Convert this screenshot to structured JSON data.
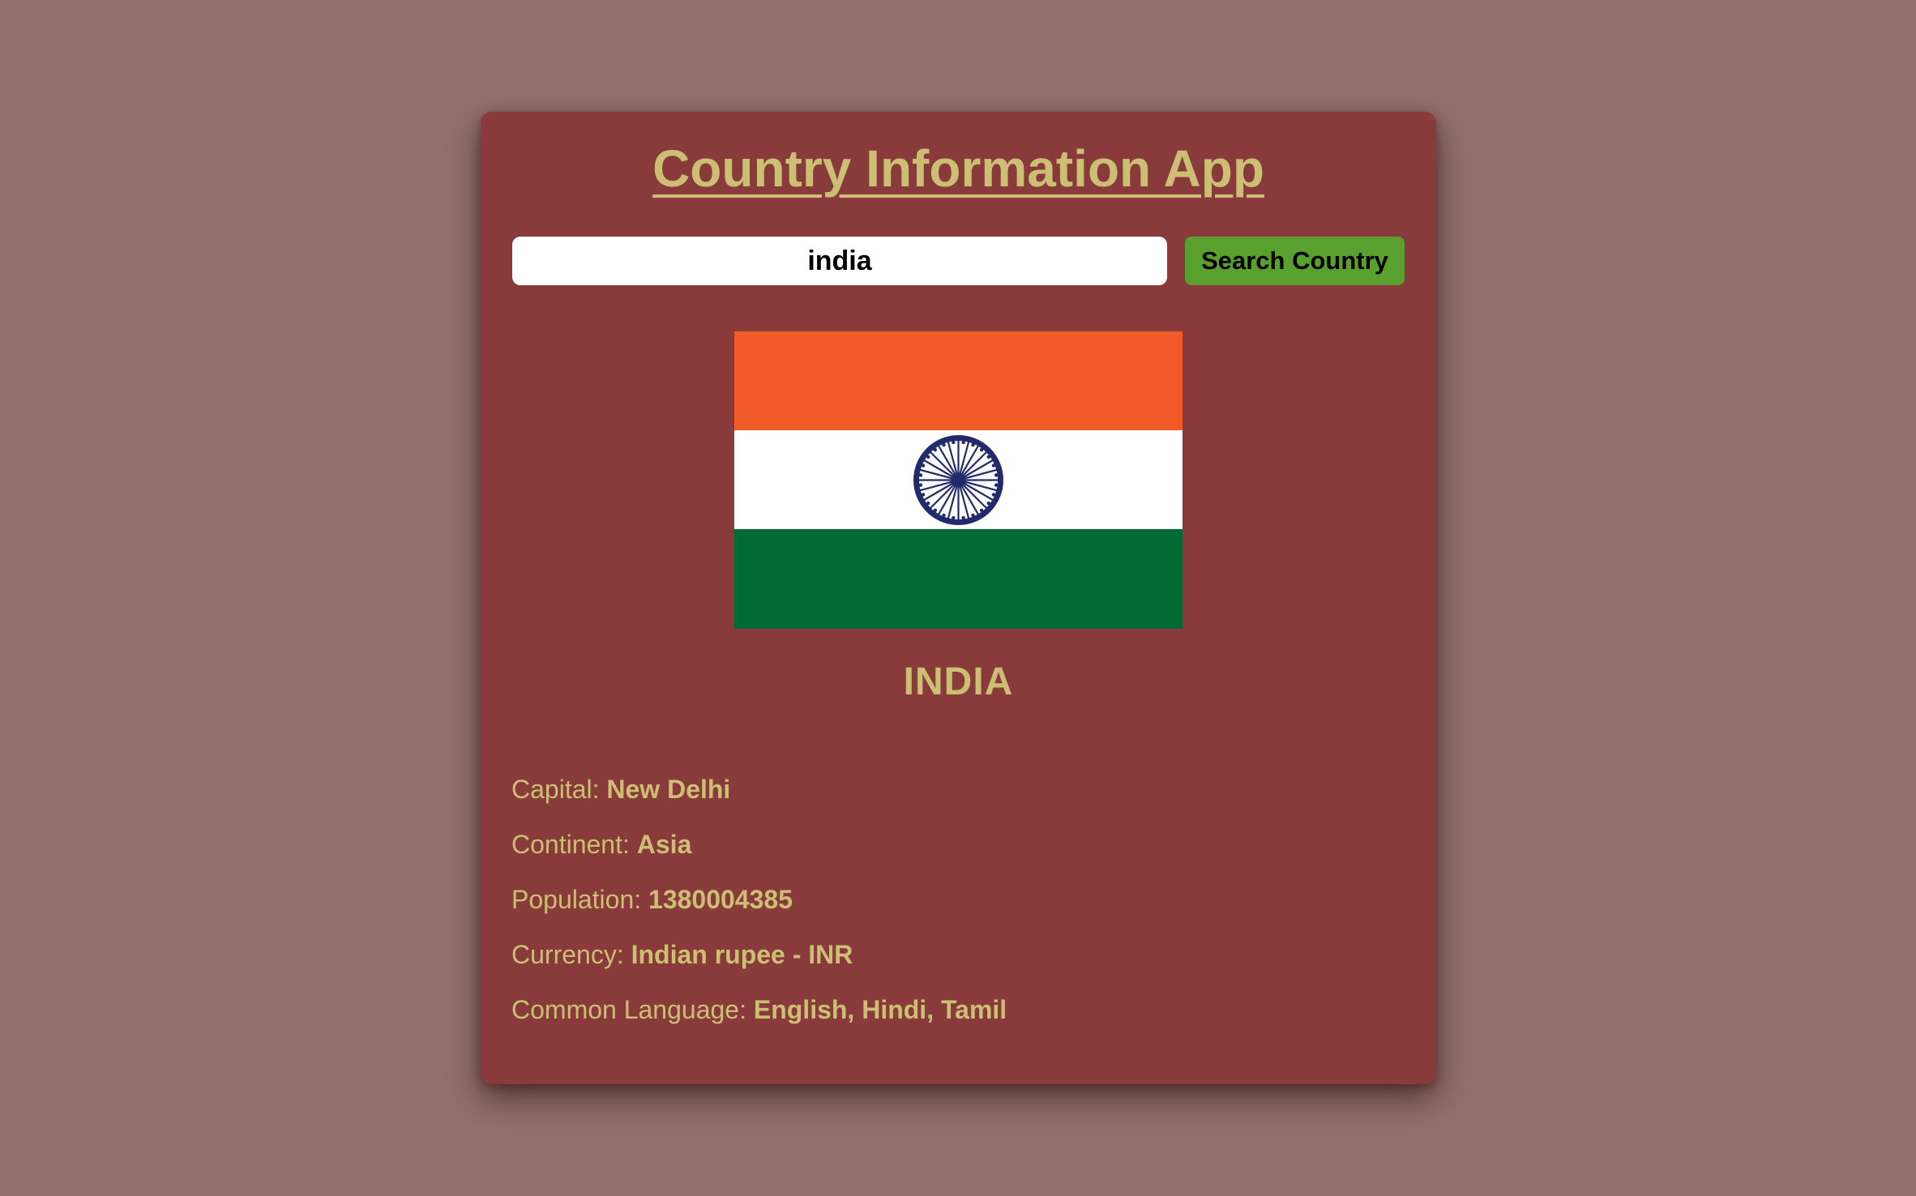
{
  "app": {
    "title": "Country Information App"
  },
  "search": {
    "value": "india",
    "button_label": "Search Country"
  },
  "country": {
    "name": "INDIA",
    "flag": {
      "stripes": [
        "#f15b27",
        "#ffffff",
        "#006a35"
      ],
      "wheel_color": "#232a6b"
    },
    "details": [
      {
        "label": "Capital:",
        "value": "New Delhi"
      },
      {
        "label": "Continent:",
        "value": "Asia"
      },
      {
        "label": "Population:",
        "value": "1380004385"
      },
      {
        "label": "Currency:",
        "value": "Indian rupee - INR"
      },
      {
        "label": "Common Language:",
        "value": "English, Hindi, Tamil"
      }
    ]
  }
}
